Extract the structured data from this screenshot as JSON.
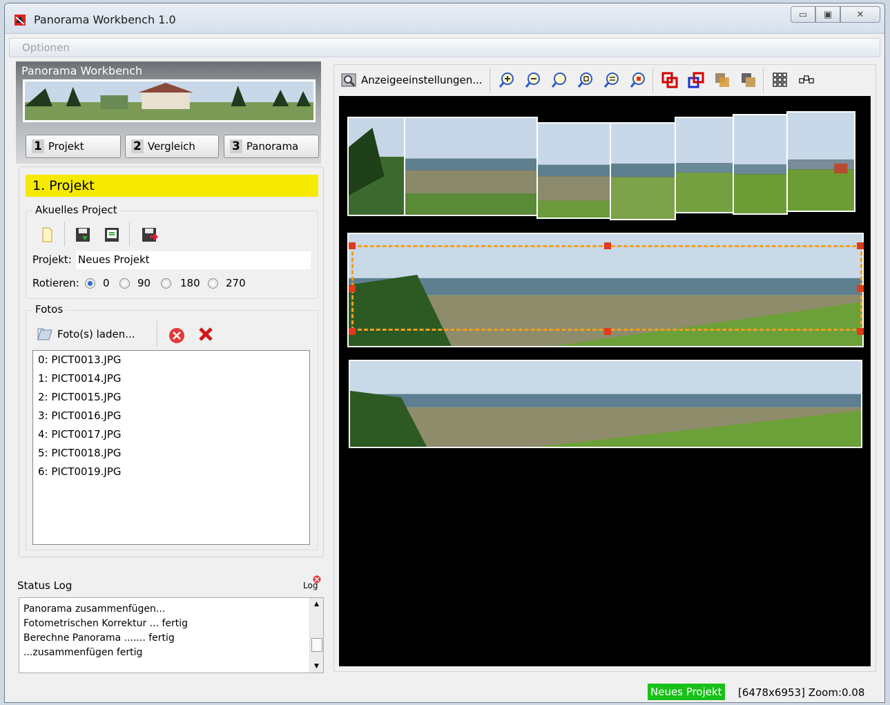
{
  "window": {
    "title": "Panorama Workbench 1.0"
  },
  "menu": {
    "items": [
      "Optionen"
    ]
  },
  "left": {
    "header_title": "Panorama Workbench",
    "steps": [
      {
        "num": "1",
        "label": "Projekt"
      },
      {
        "num": "2",
        "label": "Vergleich"
      },
      {
        "num": "3",
        "label": "Panorama"
      }
    ],
    "section_title": "1. Projekt",
    "project_group_label": "Akuelles Project",
    "project_label": "Projekt:",
    "project_value": "Neues Projekt",
    "rotate_label": "Rotieren:",
    "rotate_options": [
      "0",
      "90",
      "180",
      "270"
    ],
    "rotate_selected": "0",
    "photos_group_label": "Fotos",
    "load_photos_label": "Foto(s) laden...",
    "photo_list": [
      "0: PICT0013.JPG",
      "1: PICT0014.JPG",
      "2: PICT0015.JPG",
      "3: PICT0016.JPG",
      "4: PICT0017.JPG",
      "5: PICT0018.JPG",
      "6: PICT0019.JPG"
    ]
  },
  "status_log": {
    "label": "Status Log",
    "log_button_label": "Log",
    "lines": [
      "Panorama zusammenfügen...",
      "Fotometrischen Korrektur ... fertig",
      "Berechne Panorama ....... fertig",
      "...zusammenfügen fertig"
    ]
  },
  "toolbar": {
    "display_settings_label": "Anzeigeeinstellungen..."
  },
  "statusbar": {
    "badge": "Neues Projekt",
    "info": "[6478x6953] Zoom:0.08"
  },
  "colors": {
    "badge_bg": "#19c019",
    "section_bg": "#f5ea00",
    "selection": "#f0a020"
  }
}
